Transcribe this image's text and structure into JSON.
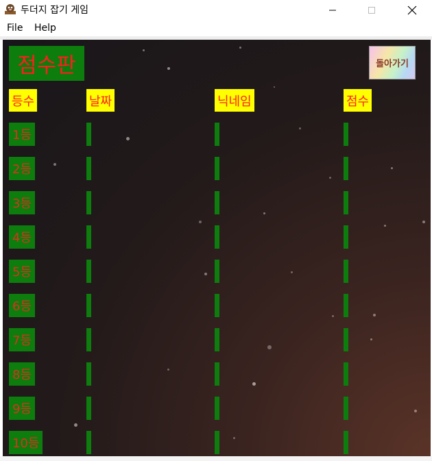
{
  "window": {
    "title": "두더지 잡기 게임",
    "icon": "app-icon",
    "controls": [
      "minimize-icon",
      "maximize-icon",
      "close-icon"
    ]
  },
  "menu": {
    "items": [
      "File",
      "Help"
    ]
  },
  "scoreboard": {
    "title": "점수판",
    "back_button": "돌아가기",
    "headers": {
      "rank": "등수",
      "date": "날짜",
      "nickname": "닉네임",
      "score": "점수"
    },
    "rows": [
      {
        "rank": "1등",
        "date": "",
        "nickname": "",
        "score": ""
      },
      {
        "rank": "2등",
        "date": "",
        "nickname": "",
        "score": ""
      },
      {
        "rank": "3등",
        "date": "",
        "nickname": "",
        "score": ""
      },
      {
        "rank": "4등",
        "date": "",
        "nickname": "",
        "score": ""
      },
      {
        "rank": "5등",
        "date": "",
        "nickname": "",
        "score": ""
      },
      {
        "rank": "6등",
        "date": "",
        "nickname": "",
        "score": ""
      },
      {
        "rank": "7등",
        "date": "",
        "nickname": "",
        "score": ""
      },
      {
        "rank": "8등",
        "date": "",
        "nickname": "",
        "score": ""
      },
      {
        "rank": "9등",
        "date": "",
        "nickname": "",
        "score": ""
      },
      {
        "rank": "10등",
        "date": "",
        "nickname": "",
        "score": ""
      }
    ]
  },
  "colors": {
    "label_green": "#0d7d0d",
    "header_yellow": "#ffff00",
    "text_red": "#ff1d1d"
  }
}
